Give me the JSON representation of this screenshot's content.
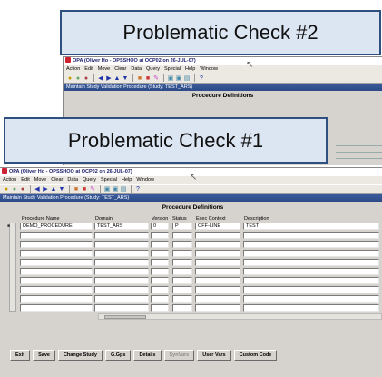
{
  "callouts": {
    "check2": "Problematic Check  #2",
    "check1": "Problematic Check  #1"
  },
  "window": {
    "title": "OPA (Oliver Ho - OPSSHOO at OCP02 on 26-JUL-07)",
    "menu": [
      "Action",
      "Edit",
      "Move",
      "Clear",
      "Data",
      "Query",
      "Special",
      "Help",
      "Window"
    ],
    "form_title": "Maintain Study Validation Procedure (Study: TEST_ARS)",
    "heading": "Procedure Definitions"
  },
  "toolbar_icons": [
    "save-icon",
    "print-icon",
    "exit-icon",
    "prev-icon",
    "next-icon",
    "up-icon",
    "down-icon",
    "insert-icon",
    "delete-icon",
    "edit-icon",
    "copy-icon",
    "paste-icon",
    "list-icon",
    "help-icon"
  ],
  "columns": [
    "Procedure Name",
    "Domain",
    "Version",
    "Status",
    "Exec Context",
    "Description"
  ],
  "rows": [
    [
      "DEMO_PROCEDURE",
      "TEST_ARS",
      "0",
      "P",
      "OFF-LINE",
      "TEST"
    ]
  ],
  "buttons": [
    {
      "label": "Exit",
      "enabled": true
    },
    {
      "label": "Save",
      "enabled": true
    },
    {
      "label": "Change Study",
      "enabled": true
    },
    {
      "label": "G.Gps",
      "enabled": true
    },
    {
      "label": "Details",
      "enabled": true
    },
    {
      "label": "SynVars",
      "enabled": false
    },
    {
      "label": "User Vars",
      "enabled": true
    },
    {
      "label": "Custom Code",
      "enabled": true
    }
  ]
}
